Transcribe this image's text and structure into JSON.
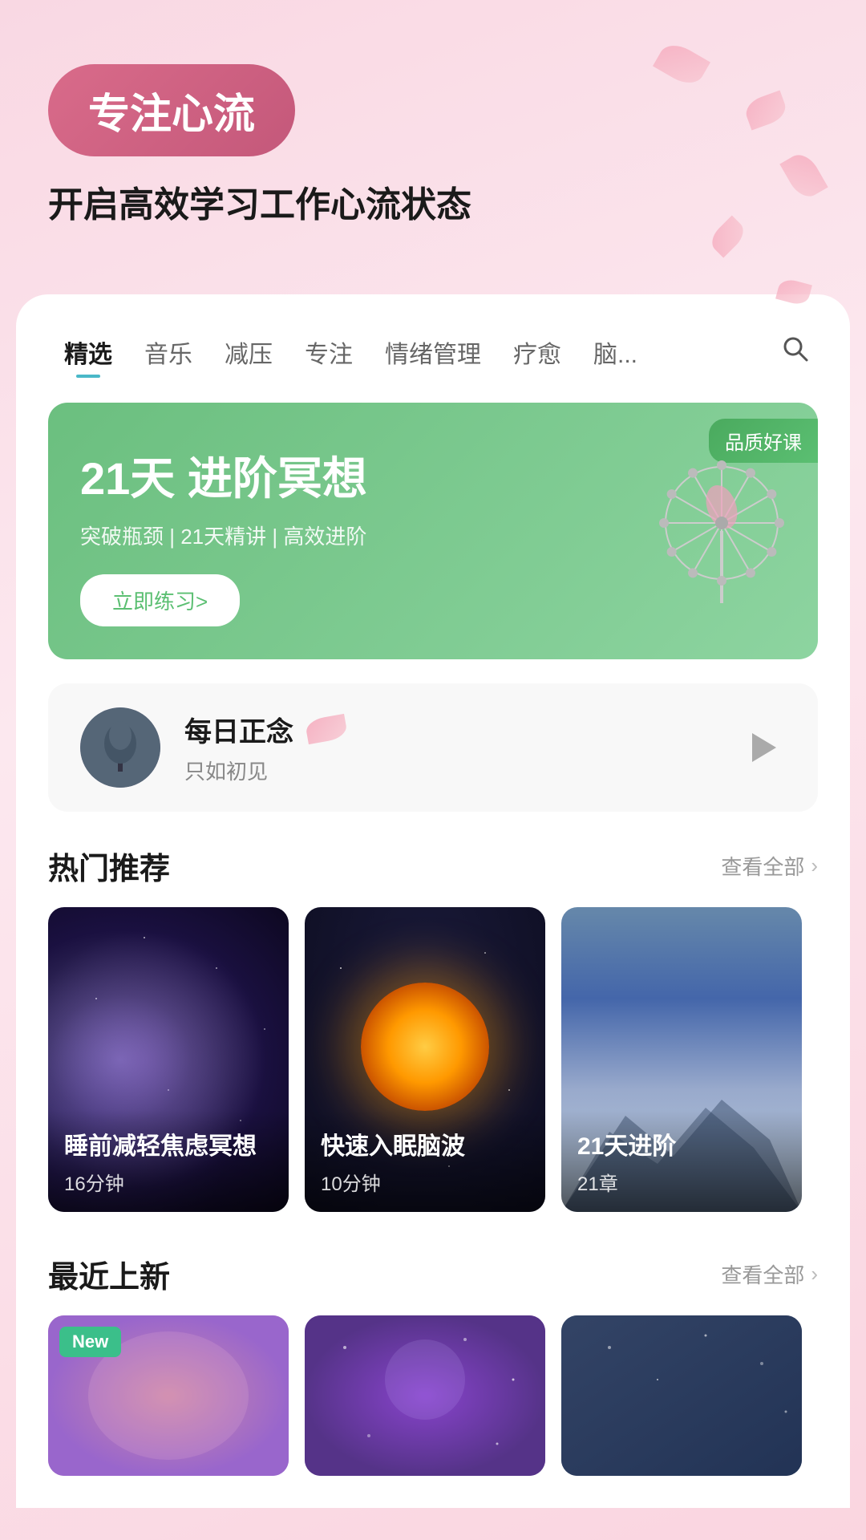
{
  "hero": {
    "badge": "专注心流",
    "subtitle": "开启高效学习工作心流状态"
  },
  "tabs": {
    "items": [
      {
        "label": "精选",
        "active": true
      },
      {
        "label": "音乐",
        "active": false
      },
      {
        "label": "减压",
        "active": false
      },
      {
        "label": "专注",
        "active": false
      },
      {
        "label": "情绪管理",
        "active": false
      },
      {
        "label": "疗愈",
        "active": false
      },
      {
        "label": "脑...",
        "active": false
      }
    ],
    "search_icon": "search"
  },
  "banner": {
    "badge": "品质好课",
    "title": "21天 进阶冥想",
    "desc": "突破瓶颈 | 21天精讲 | 高效进阶",
    "btn_label": "立即练习>",
    "dots": [
      true,
      false,
      false,
      false,
      false
    ]
  },
  "daily": {
    "title": "每日正念",
    "subtitle": "只如初见",
    "play_label": "play"
  },
  "hot_section": {
    "title": "热门推荐",
    "more_label": "查看全部",
    "items": [
      {
        "title": "睡前减轻焦虑冥想",
        "duration": "16分钟",
        "type": "galaxy"
      },
      {
        "title": "快速入眠脑波",
        "duration": "10分钟",
        "type": "orb"
      },
      {
        "title": "21天进阶",
        "duration": "21章",
        "type": "mountain"
      }
    ]
  },
  "new_section": {
    "title": "最近上新",
    "more_label": "查看全部",
    "items": [
      {
        "has_badge": true,
        "badge_label": "New",
        "type": "pink"
      },
      {
        "has_badge": false,
        "type": "purple"
      },
      {
        "has_badge": false,
        "type": "dark"
      }
    ]
  }
}
